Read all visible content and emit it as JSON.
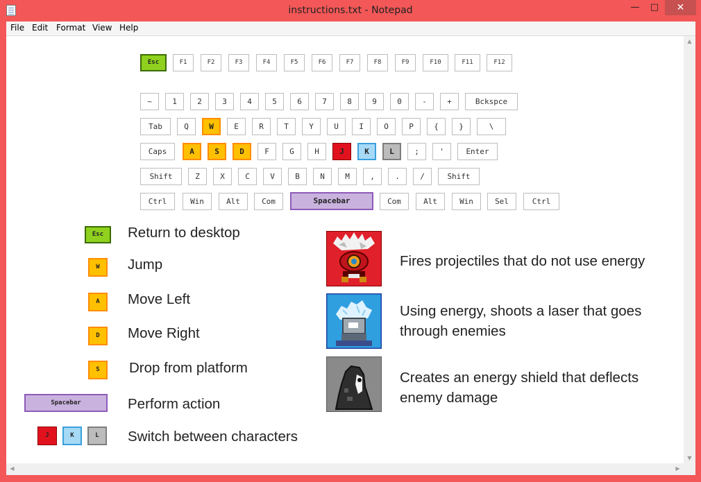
{
  "window": {
    "title": "instructions.txt - Notepad",
    "min": "—",
    "max": "□",
    "close": "✕"
  },
  "menu": [
    "File",
    "Edit",
    "Format",
    "View",
    "Help"
  ],
  "keyboard": {
    "fn_row": [
      "Esc",
      "F1",
      "F2",
      "F3",
      "F4",
      "F5",
      "F6",
      "F7",
      "F8",
      "F9",
      "F10",
      "F11",
      "F12"
    ],
    "num_row": [
      "~",
      "1",
      "2",
      "3",
      "4",
      "5",
      "6",
      "7",
      "8",
      "9",
      "0",
      "-",
      "+",
      "Bckspce"
    ],
    "q_row": [
      "Tab",
      "Q",
      "W",
      "E",
      "R",
      "T",
      "Y",
      "U",
      "I",
      "O",
      "P",
      "{",
      "}",
      "\\"
    ],
    "a_row": [
      "Caps",
      "A",
      "S",
      "D",
      "F",
      "G",
      "H",
      "J",
      "K",
      "L",
      ";",
      "'",
      "Enter"
    ],
    "z_row": [
      "Shift",
      "Z",
      "X",
      "C",
      "V",
      "B",
      "N",
      "M",
      ",",
      ".",
      "/",
      "Shift"
    ],
    "bottom_row": [
      "Ctrl",
      "Win",
      "Alt",
      "Com",
      "Spacebar",
      "Com",
      "Alt",
      "Win",
      "Sel",
      "Ctrl"
    ]
  },
  "legend": {
    "esc": {
      "key": "Esc",
      "label": "Return to desktop"
    },
    "w": {
      "key": "W",
      "label": "Jump"
    },
    "a": {
      "key": "A",
      "label": "Move Left"
    },
    "d": {
      "key": "D",
      "label": "Move Right"
    },
    "s": {
      "key": "S",
      "label": "Drop from platform"
    },
    "space": {
      "key": "Spacebar",
      "label": "Perform action"
    },
    "switch": {
      "keys": [
        "J",
        "K",
        "L"
      ],
      "label": "Switch between characters"
    }
  },
  "characters": [
    {
      "icon": "red-fire-character-icon",
      "desc": "Fires projectiles that do not use energy"
    },
    {
      "icon": "blue-ice-character-icon",
      "desc": "Using energy, shoots a laser that goes through enemies"
    },
    {
      "icon": "gray-shadow-character-icon",
      "desc": "Creates an energy shield that deflects enemy damage"
    }
  ],
  "colors": {
    "frame": "#f35757",
    "esc": "#8fd11e",
    "wasd": "#ffc000",
    "j": "#e1121e",
    "k": "#a6d9f5",
    "l": "#bcbcbc",
    "space": "#c9b3de"
  }
}
